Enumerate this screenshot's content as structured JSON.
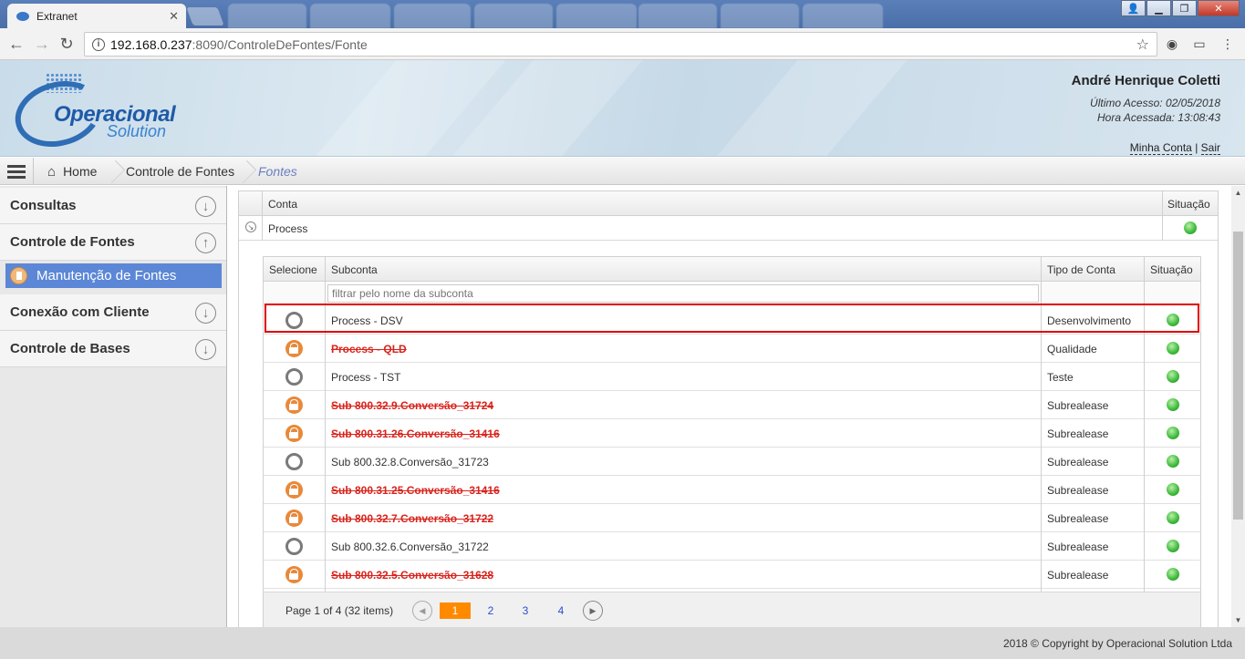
{
  "browser": {
    "active_tab": "Extranet",
    "background_tabs": [
      "",
      "",
      "",
      "",
      "",
      "",
      "",
      ""
    ],
    "url_host": "192.168.0.237",
    "url_rest": ":8090/ControleDeFontes/Fonte"
  },
  "header": {
    "brand_main": "Operacional",
    "brand_sub": "Solution",
    "user_name": "André Henrique Coletti",
    "last_access": "Último Acesso: 02/05/2018",
    "access_time": "Hora Acessada: 13:08:43",
    "my_account": "Minha Conta",
    "separator": "|",
    "logout": "Sair"
  },
  "breadcrumb": {
    "home": "Home",
    "level1": "Controle de Fontes",
    "current": "Fontes"
  },
  "sidebar": {
    "groups": [
      {
        "label": "Consultas",
        "state": "collapsed"
      },
      {
        "label": "Controle de Fontes",
        "state": "expanded"
      },
      {
        "label": "Conexão com Cliente",
        "state": "collapsed"
      },
      {
        "label": "Controle de Bases",
        "state": "collapsed"
      }
    ],
    "active_item": "Manutenção de Fontes"
  },
  "outer_table": {
    "headers": {
      "conta": "Conta",
      "situacao": "Situação"
    },
    "row": {
      "conta": "Process"
    }
  },
  "inner_table": {
    "headers": {
      "selecione": "Selecione",
      "subconta": "Subconta",
      "tipo": "Tipo de Conta",
      "situacao": "Situação"
    },
    "filter_placeholder": "filtrar pelo nome da subconta",
    "rows": [
      {
        "name": "Process - DSV",
        "tipo": "Desenvolvimento",
        "locked": false
      },
      {
        "name": "Process - QLD",
        "tipo": "Qualidade",
        "locked": true
      },
      {
        "name": "Process - TST",
        "tipo": "Teste",
        "locked": false
      },
      {
        "name": "Sub 800.32.9.Conversão_31724",
        "tipo": "Subrealease",
        "locked": true
      },
      {
        "name": "Sub 800.31.26.Conversão_31416",
        "tipo": "Subrealease",
        "locked": true
      },
      {
        "name": "Sub 800.32.8.Conversão_31723",
        "tipo": "Subrealease",
        "locked": false
      },
      {
        "name": "Sub 800.31.25.Conversão_31416",
        "tipo": "Subrealease",
        "locked": true
      },
      {
        "name": "Sub 800.32.7.Conversão_31722",
        "tipo": "Subrealease",
        "locked": true
      },
      {
        "name": "Sub 800.32.6.Conversão_31722",
        "tipo": "Subrealease",
        "locked": false
      },
      {
        "name": "Sub 800.32.5.Conversão_31628",
        "tipo": "Subrealease",
        "locked": true
      }
    ],
    "pager": {
      "label": "Page 1 of 4 (32 items)",
      "pages": [
        "1",
        "2",
        "3",
        "4"
      ],
      "current": "1"
    }
  },
  "colors": {
    "accent": "#5b87d6",
    "locked_text": "#d9231c",
    "status_ok": "#3cb83a",
    "highlight": "#e00000",
    "pager_active": "#ff8a00"
  },
  "footer": {
    "copyright": "2018 © Copyright by Operacional Solution Ltda"
  }
}
